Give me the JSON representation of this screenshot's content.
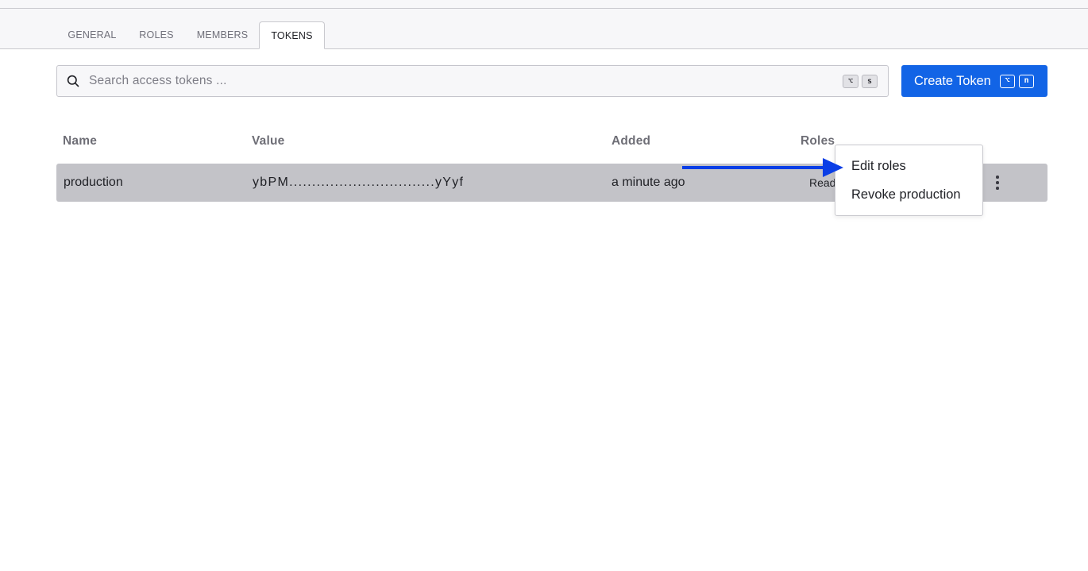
{
  "tabs": [
    {
      "label": "GENERAL"
    },
    {
      "label": "ROLES"
    },
    {
      "label": "MEMBERS"
    },
    {
      "label": "TOKENS",
      "active": true
    }
  ],
  "search": {
    "placeholder": "Search access tokens ...",
    "value": "",
    "shortcut": [
      "⌥",
      "s"
    ]
  },
  "create_button": {
    "label": "Create Token",
    "shortcut": [
      "⌥",
      "n"
    ]
  },
  "table": {
    "columns": [
      "Name",
      "Value",
      "Added",
      "Roles"
    ],
    "rows": [
      {
        "name": "production",
        "value": "ybPM................................yYyf",
        "added": "a minute ago",
        "roles": "Read"
      }
    ]
  },
  "context_menu": {
    "items": [
      "Edit roles",
      "Revoke production"
    ]
  },
  "colors": {
    "accent": "#1264e6",
    "annotation_arrow": "#0a3ee6",
    "row_highlight": "#c3c3c8"
  }
}
